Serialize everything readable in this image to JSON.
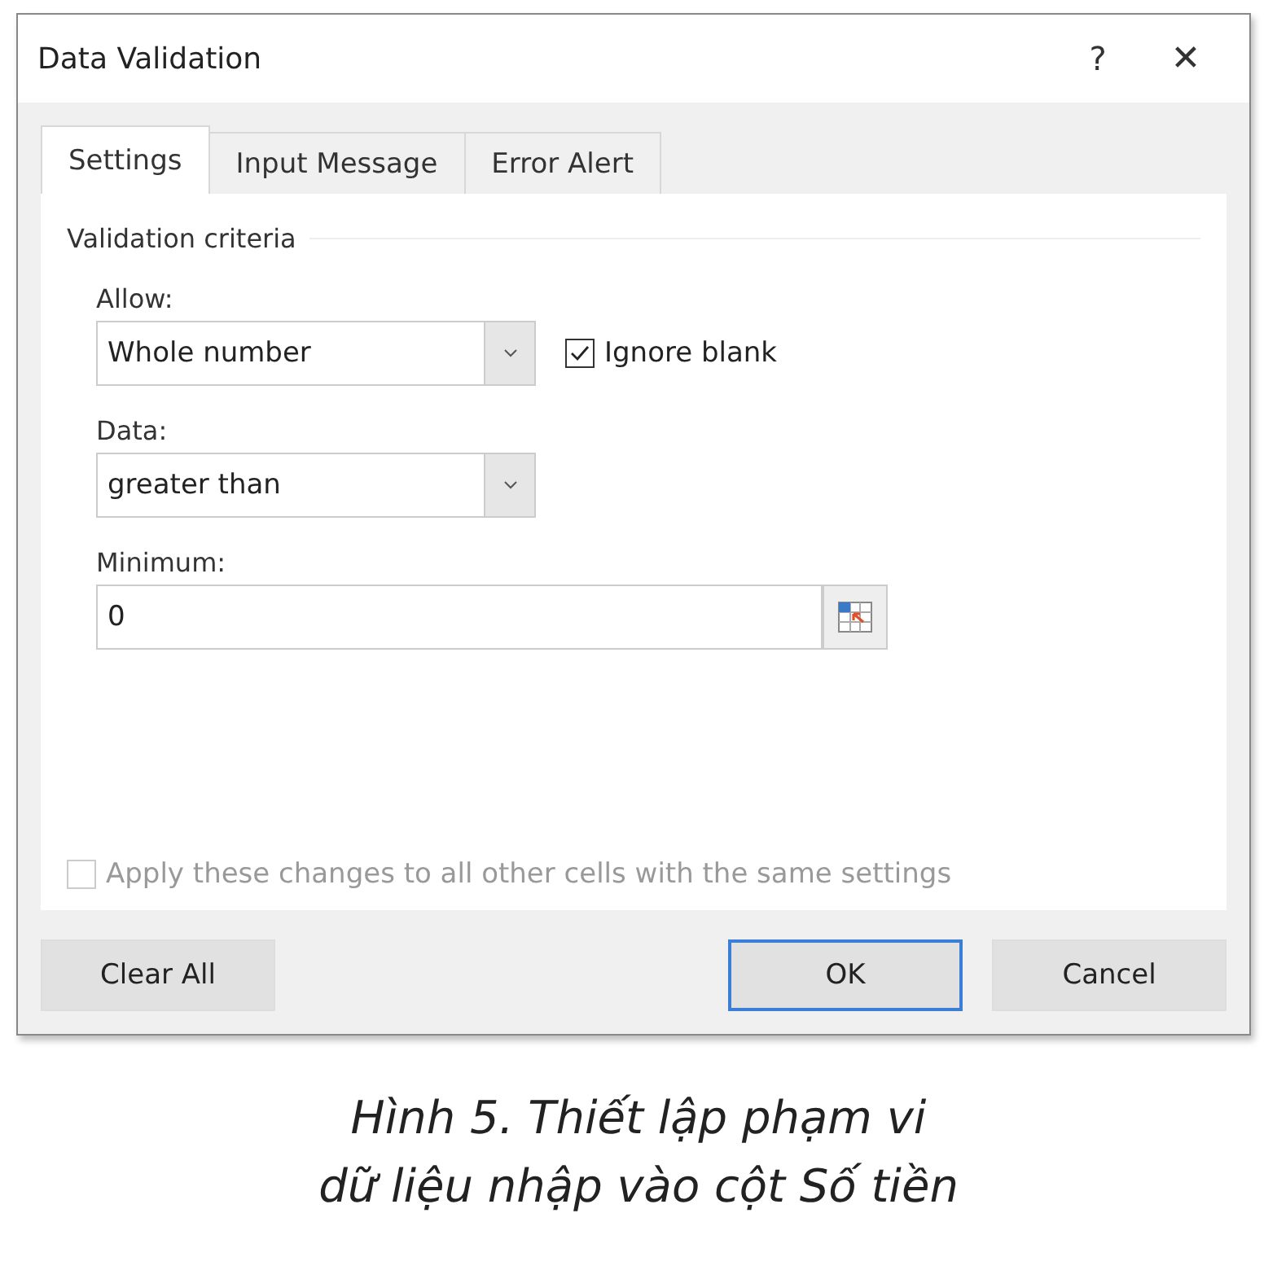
{
  "window": {
    "title": "Data Validation",
    "help": "?",
    "close": "✕"
  },
  "tabs": [
    {
      "label": "Settings",
      "selected": true
    },
    {
      "label": "Input Message",
      "selected": false
    },
    {
      "label": "Error Alert",
      "selected": false
    }
  ],
  "section_title": "Validation criteria",
  "allow": {
    "label": "Allow:",
    "value": "Whole number"
  },
  "ignore_blank": {
    "label": "Ignore blank",
    "checked": true
  },
  "data": {
    "label": "Data:",
    "value": "greater than"
  },
  "minimum": {
    "label": "Minimum:",
    "value": "0"
  },
  "apply_all": {
    "label": "Apply these changes to all other cells with the same settings",
    "checked": false,
    "disabled": true
  },
  "buttons": [
    {
      "label": "Clear All",
      "default": false
    },
    {
      "label": "OK",
      "default": true
    },
    {
      "label": "Cancel",
      "default": false
    }
  ],
  "caption": [
    "Hình 5. Thiết lập phạm vi",
    "dữ liệu nhập vào cột Số tiền"
  ]
}
